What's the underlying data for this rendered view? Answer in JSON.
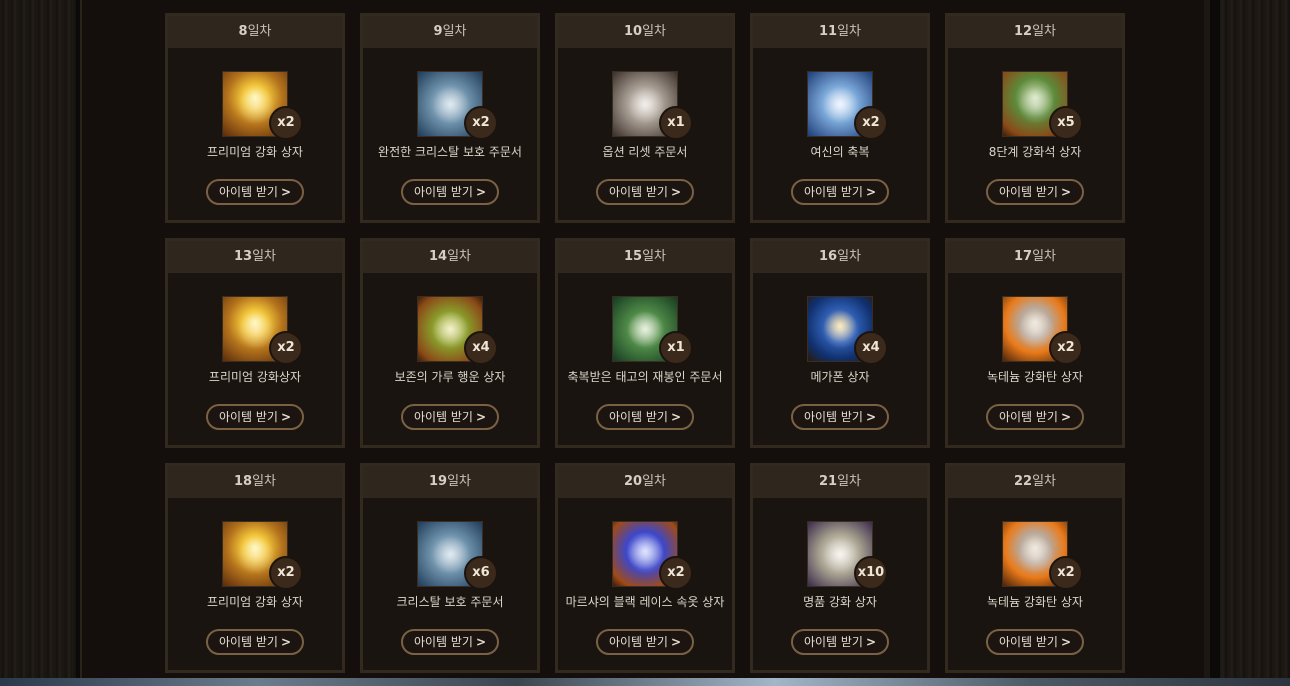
{
  "day_suffix": "일차",
  "button_label": "아이템 받기",
  "cards": [
    {
      "day": "8",
      "name": "프리미엄 강화 상자",
      "qty": "x2",
      "icon": "gold-chest-icon",
      "style": "chest-gold"
    },
    {
      "day": "9",
      "name": "완전한 크리스탈 보호 주문서",
      "qty": "x2",
      "icon": "scroll-icon",
      "style": "scroll-blue"
    },
    {
      "day": "10",
      "name": "옵션 리셋 주문서",
      "qty": "x1",
      "icon": "option-reset-scroll-icon",
      "style": "option-reset"
    },
    {
      "day": "11",
      "name": "여신의 축복",
      "qty": "x2",
      "icon": "goddess-blessing-icon",
      "style": "goddess"
    },
    {
      "day": "12",
      "name": "8단계 강화석 상자",
      "qty": "x5",
      "icon": "enchant-stone-box-icon",
      "style": "green-box"
    },
    {
      "day": "13",
      "name": "프리미엄 강화상자",
      "qty": "x2",
      "icon": "gold-chest-icon",
      "style": "chest-gold"
    },
    {
      "day": "14",
      "name": "보존의 가루 행운 상자",
      "qty": "x4",
      "icon": "lucky-box-icon",
      "style": "gold-green"
    },
    {
      "day": "15",
      "name": "축복받은 태고의 재봉인 주문서",
      "qty": "x1",
      "icon": "reseal-scroll-icon",
      "style": "scroll-green"
    },
    {
      "day": "16",
      "name": "메가폰 상자",
      "qty": "x4",
      "icon": "blue-chest-icon",
      "style": "blue-chest"
    },
    {
      "day": "17",
      "name": "녹테늄 강화탄 상자",
      "qty": "x2",
      "icon": "orange-box-icon",
      "style": "orange-box"
    },
    {
      "day": "18",
      "name": "프리미엄 강화 상자",
      "qty": "x2",
      "icon": "gold-chest-icon",
      "style": "chest-gold"
    },
    {
      "day": "19",
      "name": "크리스탈 보호 주문서",
      "qty": "x6",
      "icon": "scroll-icon",
      "style": "scroll-blue"
    },
    {
      "day": "20",
      "name": "마르샤의 블랙 레이스 속옷 상자",
      "qty": "x2",
      "icon": "purple-chest-icon",
      "style": "purple-chest"
    },
    {
      "day": "21",
      "name": "명품 강화 상자",
      "qty": "x10",
      "icon": "stone-box-icon",
      "style": "stone-box"
    },
    {
      "day": "22",
      "name": "녹테늄 강화탄 상자",
      "qty": "x2",
      "icon": "orange-box-icon",
      "style": "orange-box"
    }
  ]
}
